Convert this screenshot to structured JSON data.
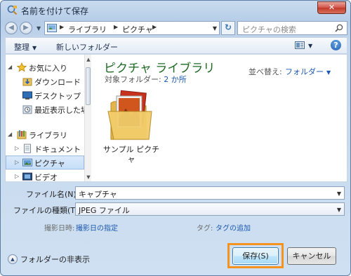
{
  "window": {
    "title": "名前を付けて保存",
    "close_glyph": "✕"
  },
  "address": {
    "back_glyph": "◀",
    "forward_glyph": "▶",
    "crumbs": [
      "ライブラリ",
      "ピクチャ"
    ],
    "refresh_glyph": "↻",
    "search_placeholder": "ピクチャの検索"
  },
  "toolbar": {
    "organize": "整理",
    "new_folder": "新しいフォルダー",
    "help": "?"
  },
  "nav": {
    "items": [
      {
        "label": "お気に入り",
        "icon": "star-icon"
      },
      {
        "label": "ダウンロード",
        "icon": "download-folder-icon"
      },
      {
        "label": "デスクトップ",
        "icon": "desktop-icon"
      },
      {
        "label": "最近表示した場所",
        "icon": "recent-places-icon"
      },
      {
        "label": "ライブラリ",
        "icon": "library-icon"
      },
      {
        "label": "ドキュメント",
        "icon": "documents-icon"
      },
      {
        "label": "ピクチャ",
        "icon": "pictures-icon"
      },
      {
        "label": "ビデオ",
        "icon": "videos-icon"
      }
    ]
  },
  "content": {
    "library_title": "ピクチャ ライブラリ",
    "target_label": "対象フォルダー:",
    "target_count": "2 か所",
    "arrange_label": "並べ替え:",
    "arrange_value": "フォルダー",
    "folder_label": "サンプル ピクチャ"
  },
  "fields": {
    "filename_label": "ファイル名(N):",
    "filename_value": "キャプチャ",
    "filetype_label": "ファイルの種類(T):",
    "filetype_value": "JPEG ファイル",
    "date_label": "撮影日時:",
    "date_link": "撮影日の指定",
    "tag_label": "タグ:",
    "tag_link": "タグの追加"
  },
  "bottom": {
    "hide_folders": "フォルダーの非表示",
    "save": "保存(S)",
    "cancel": "キャンセル"
  },
  "colors": {
    "highlight": "#f5931e",
    "library_title": "#1d6a23",
    "link": "#1c57b1"
  }
}
